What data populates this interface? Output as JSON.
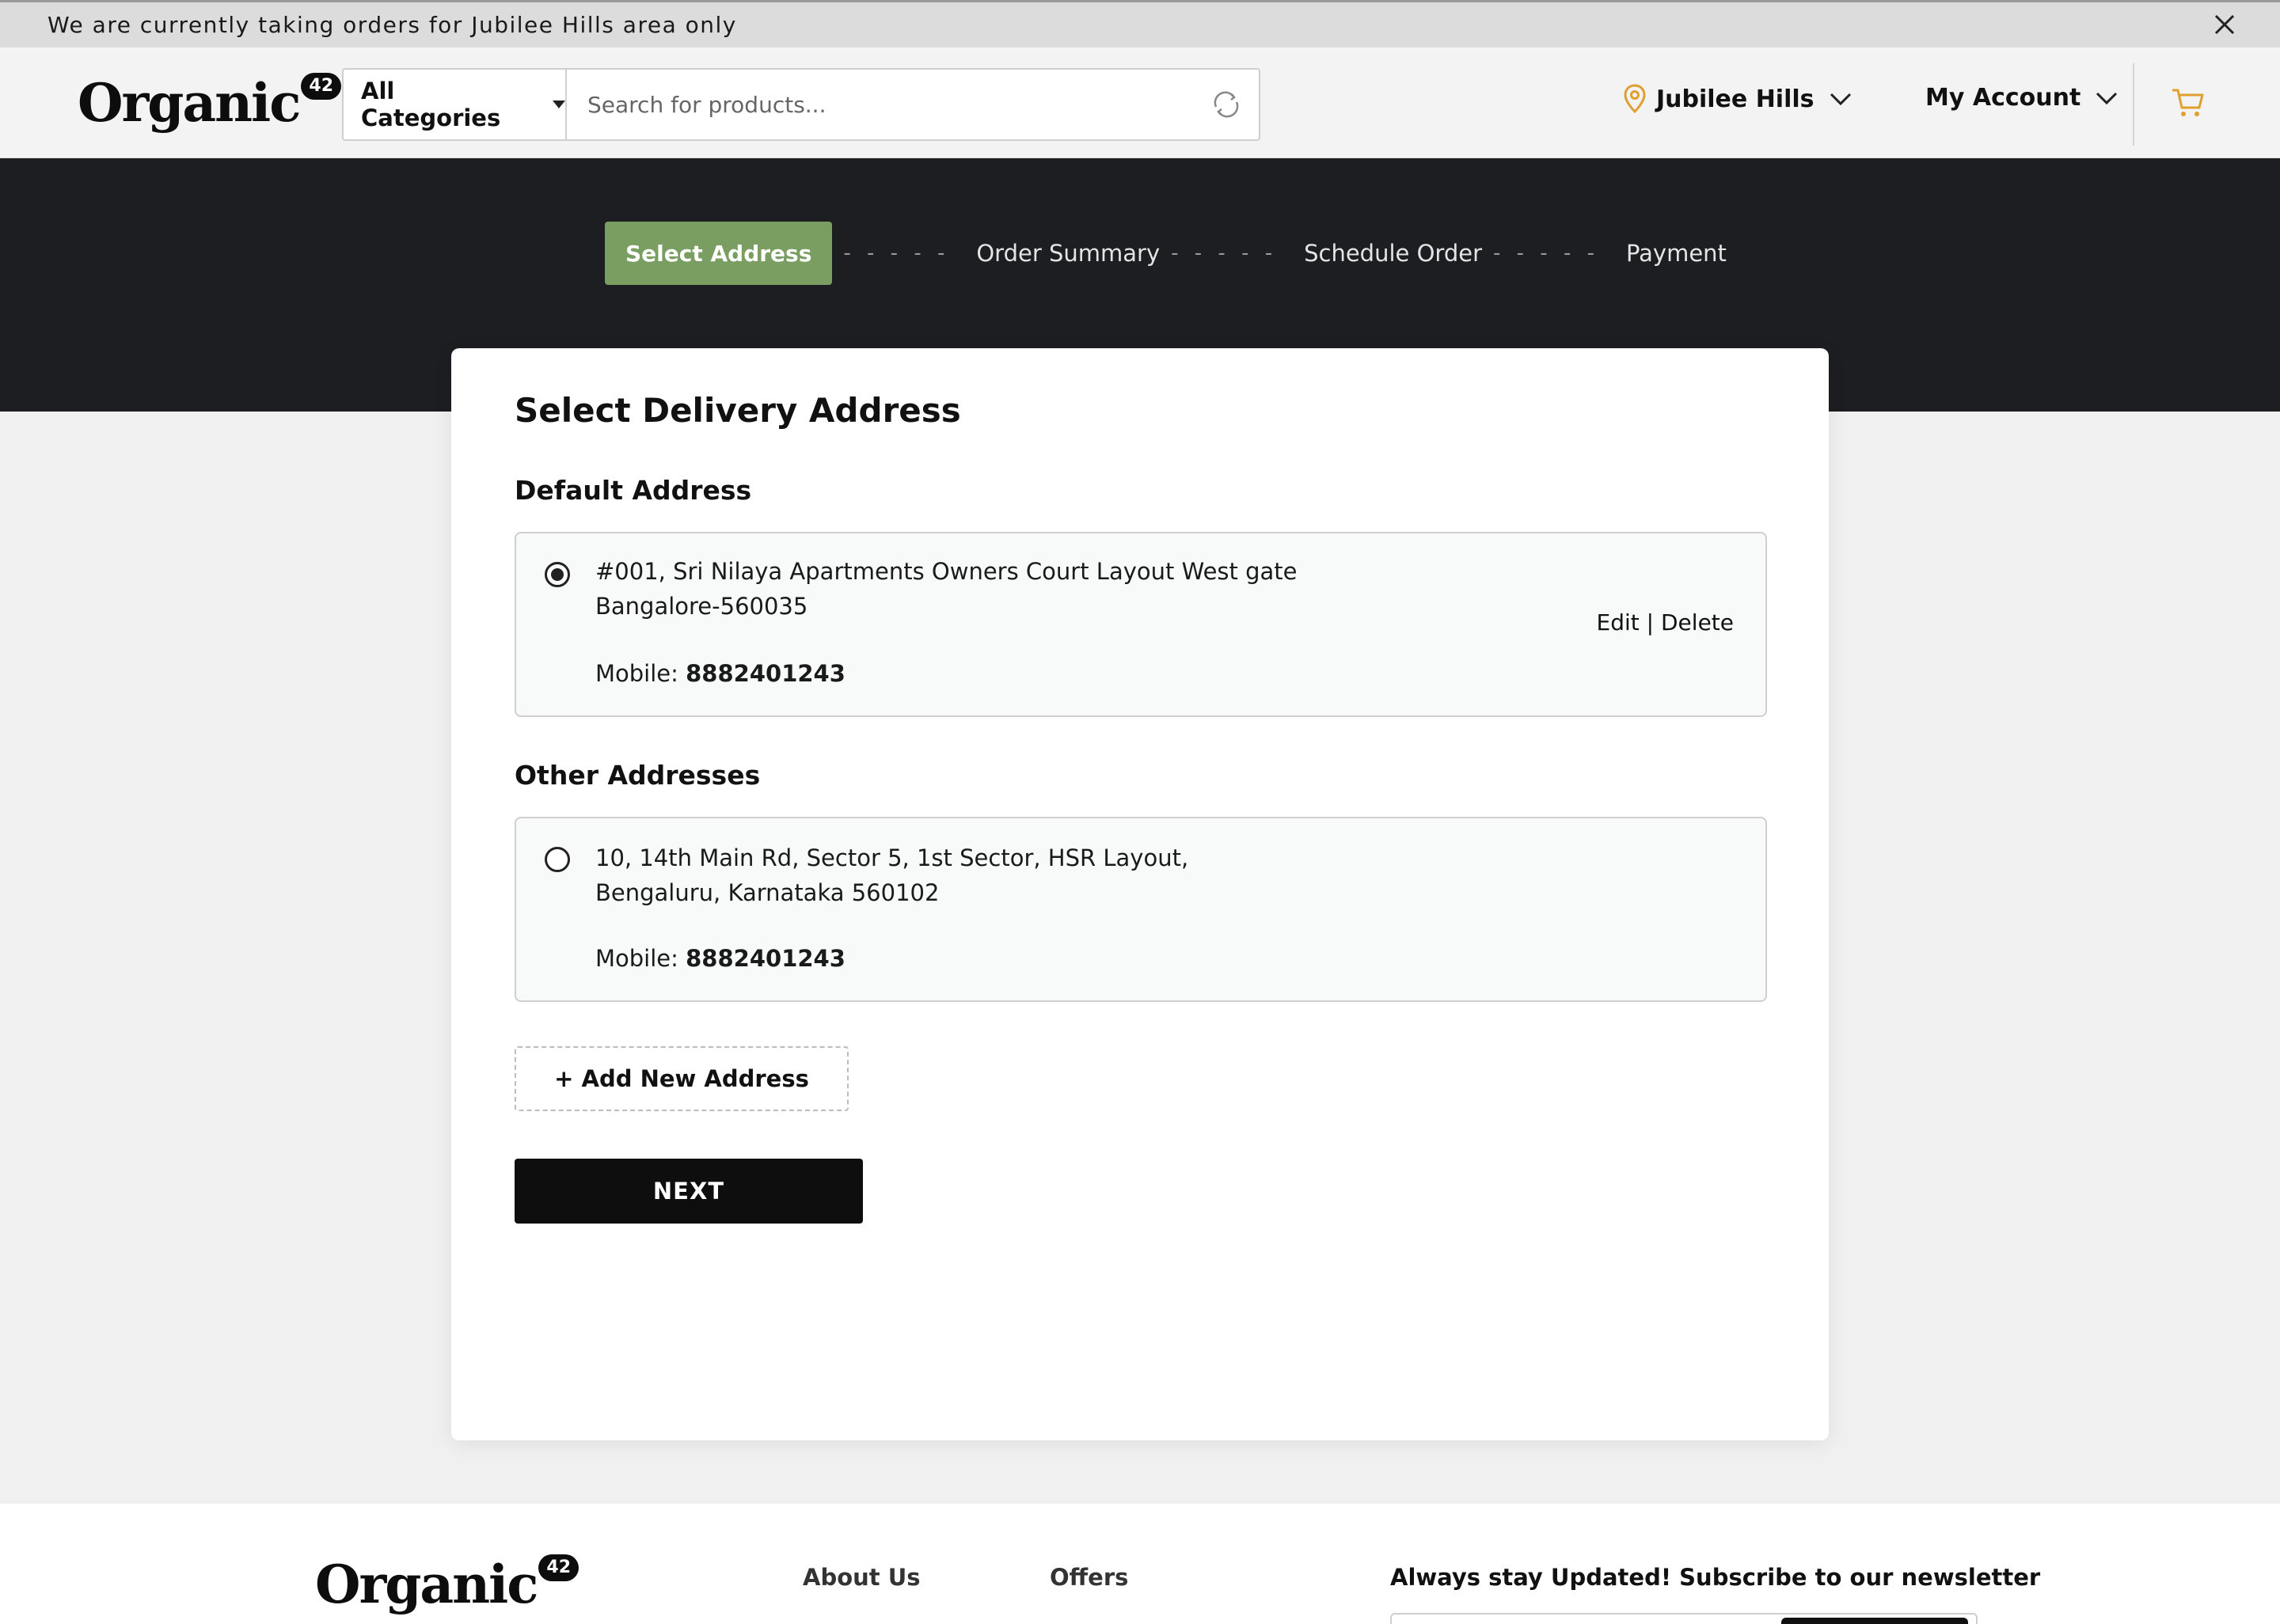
{
  "notice": {
    "text": "We are currently taking orders for Jubilee Hills area only",
    "close_icon": "close-icon"
  },
  "header": {
    "logo_word": "Organic",
    "logo_badge": "42",
    "category_label": "All Categories",
    "search_placeholder": "Search for products...",
    "location": "Jubilee Hills",
    "account": "My Account",
    "accent_color": "#e0a030"
  },
  "stepper": {
    "steps": [
      "Select Address",
      "Order Summary",
      "Schedule Order",
      "Payment"
    ],
    "active_index": 0,
    "active_color": "#7a9e62"
  },
  "main": {
    "title": "Select Delivery Address",
    "default_label": "Default Address",
    "other_label": "Other Addresses",
    "default_address": {
      "line1": "#001, Sri Nilaya Apartments Owners Court Layout West gate",
      "line2": "Bangalore-560035",
      "mobile_label": "Mobile: ",
      "mobile": "8882401243",
      "selected": true,
      "edit": "Edit",
      "separator": "|",
      "delete": "Delete"
    },
    "other_address": {
      "line1": "10, 14th Main Rd, Sector 5, 1st Sector, HSR Layout,",
      "line2": "Bengaluru, Karnataka 560102",
      "mobile_label": "Mobile: ",
      "mobile": "8882401243",
      "selected": false
    },
    "add_new": "+ Add New Address",
    "next": "NEXT"
  },
  "footer": {
    "logo_word": "Organic",
    "logo_badge": "42",
    "links": [
      "About Us",
      "Offers"
    ],
    "newsletter": "Always stay Updated! Subscribe to our newsletter"
  }
}
